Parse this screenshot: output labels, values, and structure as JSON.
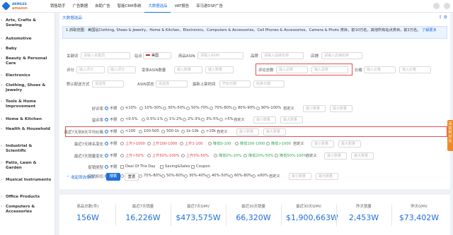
{
  "logo": {
    "line1": "AKMILES",
    "line2": "amazon"
  },
  "nav": [
    "销售助手",
    "广告数据",
    "自助广告",
    "智能CRM系统",
    "大数据选品",
    "VAT报告",
    "亚马逊DSP广告"
  ],
  "nav_active_index": 4,
  "sidebar": [
    "Arts, Crafts & Sewing",
    "Automotive",
    "Baby",
    "Beauty & Personal Care",
    "Electronics",
    "Clothing, Shoes & Jewelry",
    "Tools & Home Improvement",
    "Home & Kitchen",
    "Health & Household",
    "Industrial & Scientific",
    "Patio, Lawn & Garden",
    "Musical Instruments",
    "Office Products",
    "Computers & Accessories"
  ],
  "breadcrumb": "大数据选品",
  "notice": {
    "text": "1.抓取范围：美国站Clothing, Shoes & Jewelry、Home & Kitchen、Electronics、Computers & Accessories、Cell Phones & Accessories、Camera & Photo 类目，前10万名，其他所有站点类目，前2万名。",
    "link": "了解更多"
  },
  "filters": {
    "keyword_label": "关键词",
    "keyword_ph": "请输入关键词",
    "site_label": "站点",
    "site_value": "美国",
    "asin_label": "商品ASIN",
    "asin_ph": "请输入ASIN",
    "brand_label": "品牌",
    "brand_ph": "请输入品牌名称",
    "store_label": "店铺",
    "store_ph": "请输入店铺名称",
    "rating_label": "评分",
    "rating_min_ph": "输入评分",
    "rating_max_ph": "输入评分",
    "variant_label": "变体ASIN数量",
    "variant_min_ph": "输入数量",
    "variant_max_ph": "输入数量",
    "review_total_label": "评论总数",
    "review_min_ph": "输入总数",
    "review_max_ph": "输入总数",
    "price_label": "价格",
    "price_min_ph": "输入价格",
    "price_max_ph": "输入价格",
    "delivery_label": "默认配送方式",
    "delivery_ph": "请选择",
    "asin_status_label": "ASIN状态",
    "asin_status_ph": "请选择",
    "launch_label": "最新上架时间",
    "launch_start_ph": "开始日期",
    "launch_end_ph": "结束日期"
  },
  "option_rows": [
    {
      "label": "好评率",
      "options": [
        "不限",
        "≤10%",
        "10%-30%",
        "30%-50%",
        "50%-70%",
        "70%-80%",
        "80%-90%",
        "90%-100%",
        "自定义"
      ],
      "min_ph": "最小数量",
      "max_ph": "最大数量"
    },
    {
      "label": "留评率",
      "options": [
        "不限",
        "<0.5%",
        "0.5%-1%",
        "1%-2%",
        "2%-3%",
        "3%-5%",
        ">5%",
        "自定义"
      ],
      "min_ph": "最小数量",
      "max_ph": "最大数量"
    },
    {
      "label": "最近7天到8天平均价格",
      "options": [
        "不限",
        "<100",
        "100-500",
        "500-1k",
        "1k-10k",
        ">10k",
        "自定义"
      ],
      "min_ph": "最小数量",
      "max_ph": "最大数量"
    },
    {
      "label": "最近7天排名变化",
      "options": [
        "不限",
        "上升>1000",
        "上升100-1000",
        "上升1-100",
        "降低0-100",
        "降低100-1000",
        "降低>1000",
        "自定义"
      ],
      "min_ph": "最小数量",
      "max_ph": "最大数量"
    },
    {
      "label": "最近7天销量变化",
      "options": [
        "不限",
        "上升>50%",
        "上升50%-100%",
        "上升0%-50%",
        "降低0%-20%",
        "降低20%-50%",
        "降低50%-100%",
        "自定义"
      ],
      "min_ph": "最小数量",
      "max_ph": "最大数量"
    },
    {
      "label": "促销类型",
      "options": [
        "不限",
        "Deal Of The Day",
        "Saving&Sales",
        "Coupon"
      ]
    },
    {
      "label": "促销折扣",
      "options": [
        "不限",
        "≥80%",
        "70%-80%",
        "50%-60%",
        "30%-40%",
        "40%-50%",
        "60%-80%",
        "≤60%",
        "自定义"
      ],
      "min_ph": "最小数量",
      "max_ph": "最大数量"
    }
  ],
  "collapse_label": "收起筛选条件",
  "search_btn": "搜索",
  "reset_btn": "重置",
  "stats": [
    {
      "title": "商品总数(件)",
      "value": "156W"
    },
    {
      "title": "最近7天销量",
      "value": "16,226W"
    },
    {
      "title": "最近7天GMV",
      "value": "$473,575W"
    },
    {
      "title": "最近30天销量",
      "value": "66,320W"
    },
    {
      "title": "最近30天GMV",
      "value": "$1,900,663W"
    },
    {
      "title": "昨天销量",
      "value": "2,453W"
    },
    {
      "title": "昨天GMV",
      "value": "$73,402W"
    }
  ],
  "sidetab": "添加到对比"
}
